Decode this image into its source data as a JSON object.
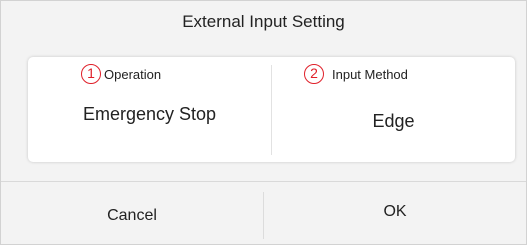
{
  "dialog": {
    "title": "External Input Setting"
  },
  "settings": [
    {
      "number": "1",
      "label": "Operation",
      "value": "Emergency Stop"
    },
    {
      "number": "2",
      "label": "Input Method",
      "value": "Edge"
    }
  ],
  "buttons": {
    "cancel_label": "Cancel",
    "ok_label": "OK"
  },
  "colors": {
    "marker": "#e0202a",
    "background": "#f3f3f3",
    "card": "#ffffff"
  }
}
